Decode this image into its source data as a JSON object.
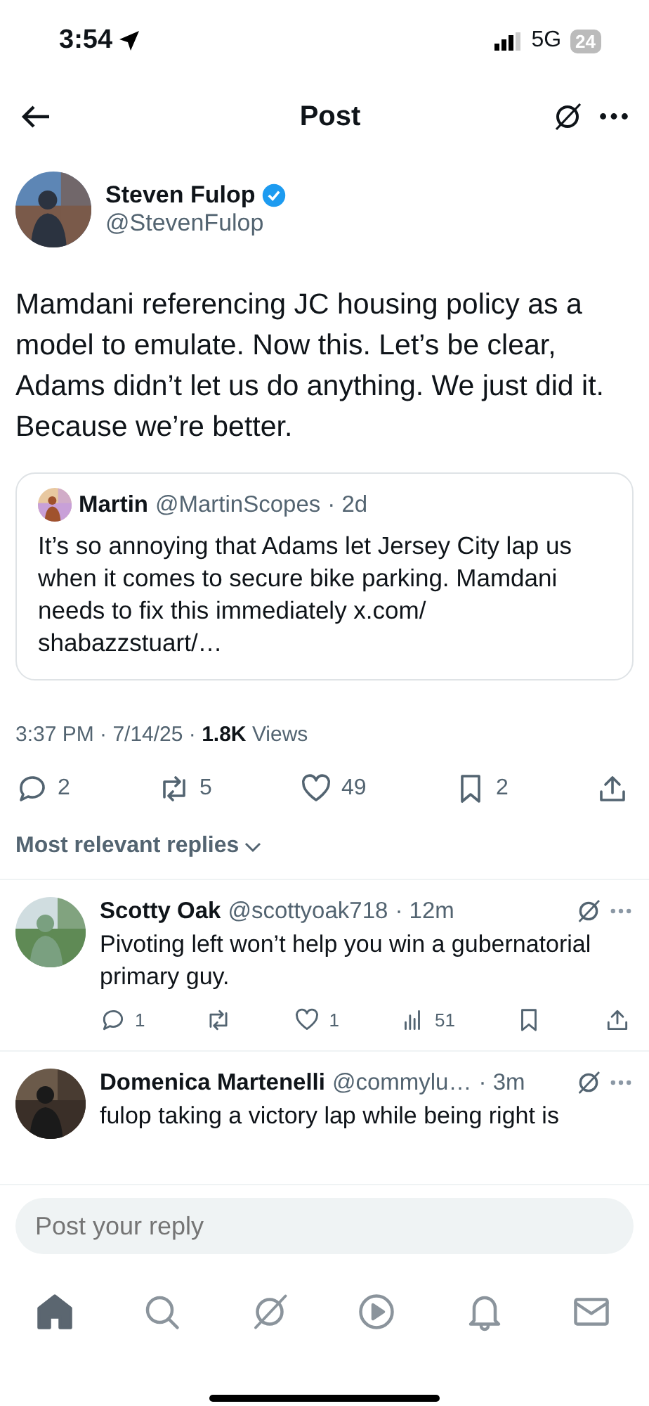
{
  "status_bar": {
    "time": "3:54",
    "network": "5G",
    "battery": "24"
  },
  "header": {
    "title": "Post"
  },
  "post": {
    "author": "Steven Fulop",
    "handle": "@StevenFulop",
    "verified": true,
    "text": "Mamdani referencing JC housing policy as a model to emulate. Now this. Let’s be clear, Adams didn’t let us do anything. We just did it. Because we’re better.",
    "quote": {
      "author": "Martin",
      "handle": "@MartinScopes",
      "time": "· 2d",
      "text": "It’s so annoying that Adams let Jersey City lap us when it comes to secure bike parking. Mamdani needs to fix this immediately x.com/ shabazzstuart/…"
    },
    "meta": {
      "timestamp": "3:37 PM · 7/14/25 · ",
      "views_count": "1.8K",
      "views_label": "Views"
    },
    "actions": [
      {
        "kind": "reply",
        "count": "2"
      },
      {
        "kind": "repost",
        "count": "5"
      },
      {
        "kind": "like",
        "count": "49"
      },
      {
        "kind": "bookmark",
        "count": "2"
      },
      {
        "kind": "share"
      }
    ]
  },
  "replies_filter": "Most relevant replies",
  "replies": [
    {
      "author": "Scotty Oak",
      "handle": "@scottyoak718",
      "time": "· 12m",
      "text": "Pivoting left won’t help you win a gubernatorial primary guy.",
      "actions": [
        {
          "kind": "reply",
          "count": "1"
        },
        {
          "kind": "repost"
        },
        {
          "kind": "like",
          "count": "1"
        },
        {
          "kind": "views",
          "count": "51"
        },
        {
          "kind": "bookmark"
        },
        {
          "kind": "share"
        }
      ]
    },
    {
      "author": "Domenica Martenelli",
      "handle": "@commylu…",
      "time": "· 3m",
      "text": "fulop taking a victory lap while being right is"
    }
  ],
  "composer": {
    "placeholder": "Post your reply"
  },
  "tabs": [
    {
      "kind": "home",
      "selected": true
    },
    {
      "kind": "search",
      "selected": false
    },
    {
      "kind": "grok",
      "selected": false
    },
    {
      "kind": "video",
      "selected": false
    },
    {
      "kind": "notifications",
      "selected": false
    },
    {
      "kind": "messages",
      "selected": false
    }
  ]
}
